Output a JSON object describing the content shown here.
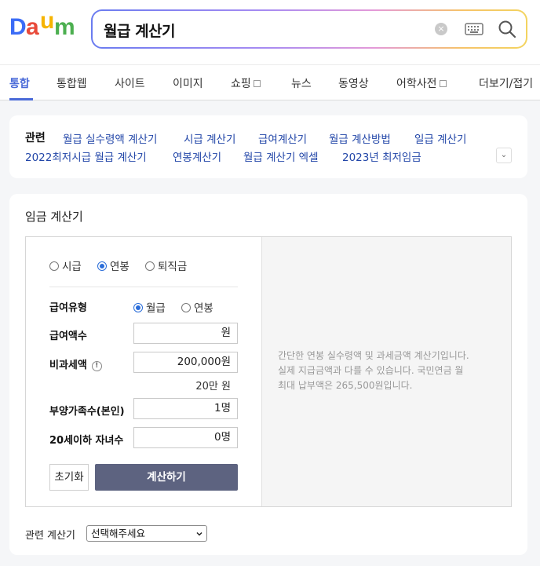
{
  "logo": {
    "letters": [
      "D",
      "a",
      "u",
      "m"
    ],
    "colors": [
      "#3b6cf6",
      "#e84a3a",
      "#f6b400",
      "#4caf50"
    ]
  },
  "search": {
    "query": "월급 계산기",
    "clear_glyph": "×"
  },
  "tabs": [
    {
      "label": "통합",
      "active": true
    },
    {
      "label": "통합웹"
    },
    {
      "label": "사이트"
    },
    {
      "label": "이미지"
    },
    {
      "label": "쇼핑"
    },
    {
      "label": "뉴스"
    },
    {
      "label": "동영상"
    },
    {
      "label": "어학사전"
    },
    {
      "label": "더보기/접기"
    }
  ],
  "related": {
    "title": "관련",
    "links": [
      "월급 실수령액 계산기",
      "시급 계산기",
      "급여계산기",
      "월급 계산방법",
      "일급 계산기",
      "2022최저시급 월급 계산기",
      "연봉계산기",
      "월급 계산기 엑셀",
      "2023년 최저임금"
    ],
    "toggle_glyph": "⌄"
  },
  "calculator": {
    "title": "임금 계산기",
    "mode_options": [
      "시급",
      "연봉",
      "퇴직금"
    ],
    "mode_selected": "연봉",
    "pay_type_label": "급여유형",
    "pay_type_options": [
      "월급",
      "연봉"
    ],
    "pay_type_selected": "월급",
    "amount_label": "급여액수",
    "amount_value": "원",
    "nontax_label": "비과세액",
    "nontax_info": "!",
    "nontax_value": "200,000원",
    "nontax_note": "20만 원",
    "family_label": "부양가족수(본인)",
    "family_value": "1명",
    "children_label": "20세이하 자녀수",
    "children_value": "0명",
    "reset_label": "초기화",
    "calc_label": "계산하기",
    "info_lines": [
      "간단한 연봉 실수령액 및 과세금액 계산기입니다.",
      "실제 지급금액과 다를 수 있습니다. 국민연금 월",
      "최대 납부액은 265,500원입니다."
    ],
    "related_calc_label": "관련 계산기",
    "related_calc_selected": "선택해주세요"
  }
}
